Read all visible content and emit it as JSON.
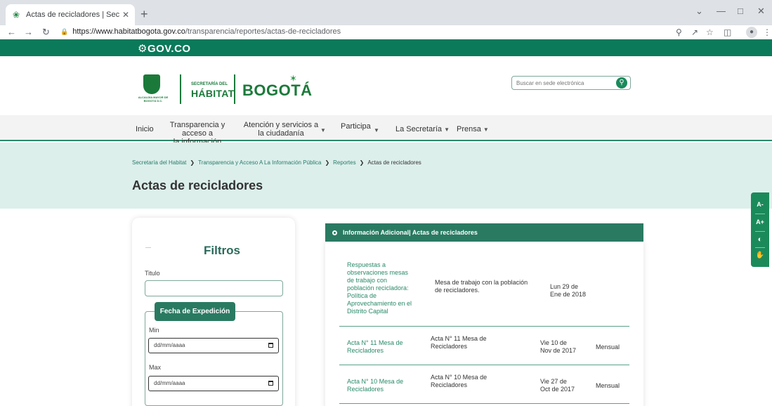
{
  "browser": {
    "tab_title": "Actas de recicladores | Secretaría",
    "url_host": "https://www.habitatbogota.gov.co",
    "url_path": "/transparencia/reportes/actas-de-recicladores"
  },
  "gov": {
    "logo": "GOV.CO"
  },
  "header": {
    "seal_text": "ALCALDÍA MAYOR DE BOGOTÁ D.C.",
    "secretaria_small": "SECRETARÍA DEL",
    "secretaria_big": "HÁBITAT",
    "bogota": "BOGOTÁ",
    "search_placeholder": "Buscar en sede electrónica"
  },
  "nav": {
    "inicio": "Inicio",
    "transparencia_1": "Transparencia y acceso a",
    "transparencia_2": "la información pública",
    "atencion_1": "Atención y servicios a",
    "atencion_2": "la ciudadanía",
    "participa": "Participa",
    "secretaria": "La Secretaría",
    "prensa": "Prensa"
  },
  "breadcrumb": {
    "b1": "Secretaría del Habitat",
    "b2": "Transparencia y Acceso A La Información Pública",
    "b3": "Reportes",
    "b4": "Actas de recicladores"
  },
  "page_title": "Actas de recicladores",
  "accessibility": {
    "decrease": "A-",
    "increase": "A+"
  },
  "filters": {
    "title": "Filtros",
    "titulo_label": "Titulo",
    "fecha_label": "Fecha de Expedición",
    "min_label": "Min",
    "max_label": "Max",
    "date_placeholder": "dd/mm/aaaa"
  },
  "info": {
    "header": "Información Adicional| Actas de recicladores",
    "rows": [
      {
        "title_lines": [
          "Respuestas a",
          "observaciones mesas",
          "de trabajo con",
          "población recicladora:",
          "Política de",
          "Aprovechamiento en el",
          "Distrito Capital"
        ],
        "desc_lines": [
          "Mesa de trabajo con la población",
          "de recicladores."
        ],
        "date_lines": [
          "Lun 29 de",
          "Ene de 2018"
        ],
        "period": ""
      },
      {
        "title_lines": [
          "Acta N° 11 Mesa de",
          "Recicladores"
        ],
        "desc_lines": [
          "Acta N° 11 Mesa de",
          "Recicladores"
        ],
        "date_lines": [
          "Vie 10 de",
          "Nov de 2017"
        ],
        "period": "Mensual"
      },
      {
        "title_lines": [
          "Acta N° 10 Mesa de",
          "Recicladores"
        ],
        "desc_lines": [
          "Acta N° 10 Mesa de",
          "Recicladores"
        ],
        "date_lines": [
          "Vie 27 de",
          "Oct de 2017"
        ],
        "period": "Mensual"
      }
    ]
  }
}
